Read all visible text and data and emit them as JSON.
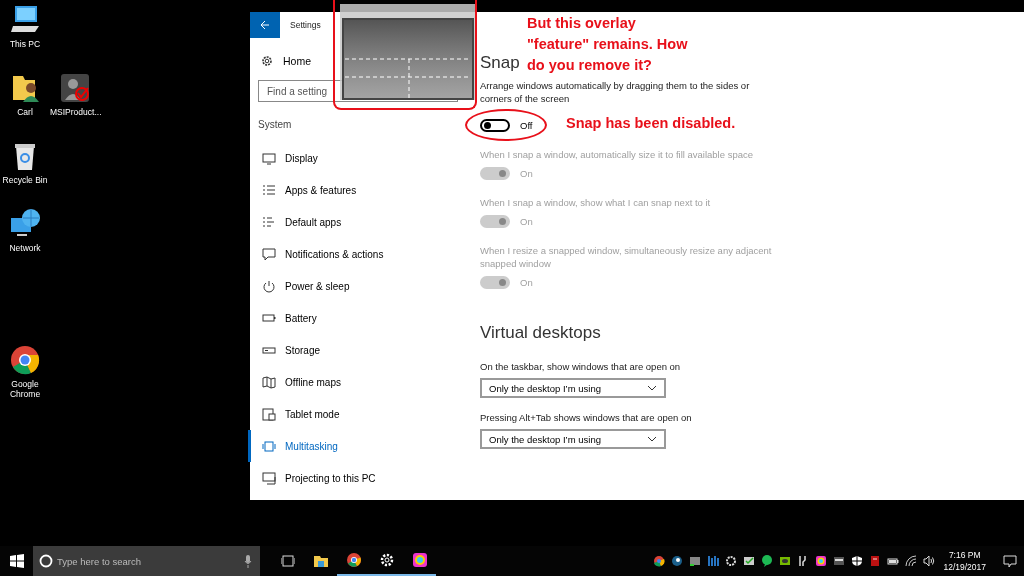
{
  "desktop_icons": [
    {
      "label": "This PC",
      "kind": "pc"
    },
    {
      "label": "Carl",
      "kind": "user-folder"
    },
    {
      "label": "MSIProduct...",
      "kind": "msi"
    },
    {
      "label": "Recycle Bin",
      "kind": "bin"
    },
    {
      "label": "Network",
      "kind": "network"
    },
    {
      "label": "Google Chrome",
      "kind": "chrome"
    }
  ],
  "settings": {
    "title": "Settings",
    "home": "Home",
    "search": {
      "placeholder": "Find a setting"
    },
    "section": "System",
    "items": [
      {
        "label": "Display",
        "kind": "display",
        "selected": false
      },
      {
        "label": "Apps & features",
        "kind": "apps",
        "selected": false
      },
      {
        "label": "Default apps",
        "kind": "default",
        "selected": false
      },
      {
        "label": "Notifications & actions",
        "kind": "notify",
        "selected": false
      },
      {
        "label": "Power & sleep",
        "kind": "power",
        "selected": false
      },
      {
        "label": "Battery",
        "kind": "battery",
        "selected": false
      },
      {
        "label": "Storage",
        "kind": "storage",
        "selected": false
      },
      {
        "label": "Offline maps",
        "kind": "maps",
        "selected": false
      },
      {
        "label": "Tablet mode",
        "kind": "tablet",
        "selected": false
      },
      {
        "label": "Multitasking",
        "kind": "multitask",
        "selected": true
      },
      {
        "label": "Projecting to this PC",
        "kind": "project",
        "selected": false
      }
    ],
    "snap": {
      "heading": "Snap",
      "description": "Arrange windows automatically by dragging them to the sides or corners of the screen",
      "toggles": [
        {
          "state": "Off",
          "on": false,
          "disabled": false
        },
        {
          "label": "When I snap a window, automatically size it to fill available space",
          "state": "On",
          "on": true,
          "disabled": true
        },
        {
          "label": "When I snap a window, show what I can snap next to it",
          "state": "On",
          "on": true,
          "disabled": true
        },
        {
          "label": "When I resize a snapped window, simultaneously resize any adjacent snapped window",
          "state": "On",
          "on": true,
          "disabled": true
        }
      ]
    },
    "virtual_desktops": {
      "heading": "Virtual desktops",
      "dropdowns": [
        {
          "label": "On the taskbar, show windows that are open on",
          "value": "Only the desktop I’m using"
        },
        {
          "label": "Pressing Alt+Tab shows windows that are open on",
          "value": "Only the desktop I’m using"
        }
      ]
    }
  },
  "annotations": [
    {
      "text": "But this overlay \"feature\" remains. How do you remove it?",
      "kind": "note"
    },
    {
      "text": "Snap has been disabled.",
      "kind": "status"
    }
  ],
  "taskbar": {
    "search": {
      "placeholder": "Type here to search"
    },
    "time": "7:16 PM",
    "date": "12/19/2017"
  }
}
